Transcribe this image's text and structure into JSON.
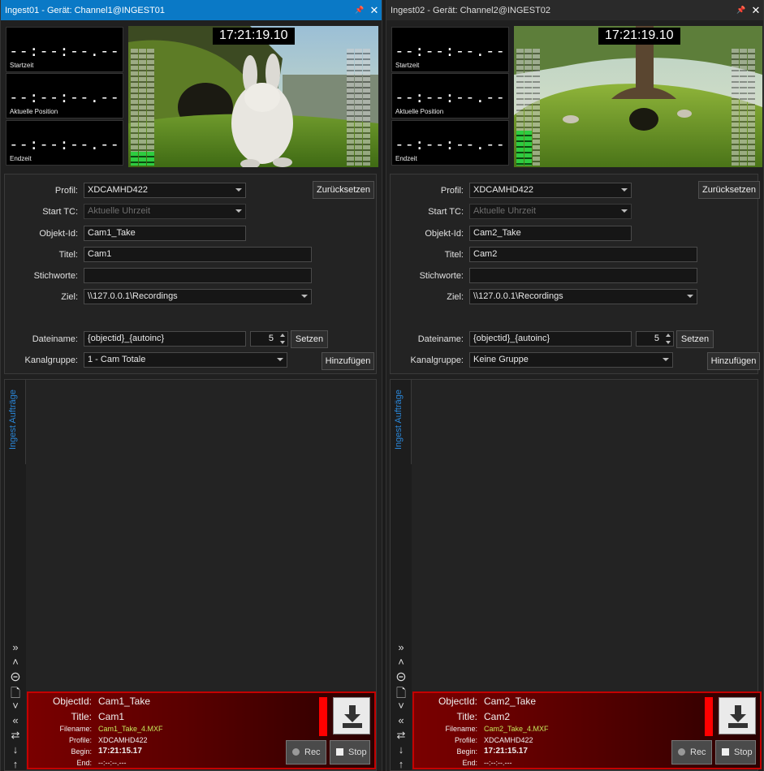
{
  "panels": [
    {
      "title": "Ingest01 - Gerät: Channel1@INGEST01",
      "timecodes": {
        "start": {
          "value": "--:--:--.--",
          "label": "Startzeit"
        },
        "current": {
          "value": "--:--:--.--",
          "label": "Aktuelle Position"
        },
        "end": {
          "value": "--:--:--.--",
          "label": "Endzeit"
        }
      },
      "video_timecode": "17:21:19.10",
      "meter_levels": [
        0.12,
        0.12,
        0.0,
        0.0
      ],
      "form": {
        "profil_label": "Profil:",
        "profil_value": "XDCAMHD422",
        "starttc_label": "Start TC:",
        "starttc_value": "Aktuelle Uhrzeit",
        "objektid_label": "Objekt-Id:",
        "objektid_value": "Cam1_Take",
        "titel_label": "Titel:",
        "titel_value": "Cam1",
        "stichworte_label": "Stichworte:",
        "stichworte_value": "",
        "ziel_label": "Ziel:",
        "ziel_value": "\\\\127.0.0.1\\Recordings",
        "dateiname_label": "Dateiname:",
        "dateiname_value": "{objectid}_{autoinc}",
        "counter_value": "5",
        "kanalgruppe_label": "Kanalgruppe:",
        "kanalgruppe_value": "1 - Cam Totale",
        "reset_label": "Zurücksetzen",
        "setzen_label": "Setzen",
        "add_label": "Hinzufügen"
      },
      "jobs_tab": "Ingest Aufträge",
      "record": {
        "objectid_label": "ObjectId:",
        "objectid": "Cam1_Take",
        "title_label": "Title:",
        "title": "Cam1",
        "filename_label": "Filename:",
        "filename": "Cam1_Take_4.MXF",
        "profile_label": "Profile:",
        "profile": "XDCAMHD422",
        "begin_label": "Begin:",
        "begin": "17:21:15.17",
        "end_label": "End:",
        "end": "--:--:--.---",
        "rec_label": "Rec",
        "stop_label": "Stop"
      }
    },
    {
      "title": "Ingest02 - Gerät: Channel2@INGEST02",
      "timecodes": {
        "start": {
          "value": "--:--:--.--",
          "label": "Startzeit"
        },
        "current": {
          "value": "--:--:--.--",
          "label": "Aktuelle Position"
        },
        "end": {
          "value": "--:--:--.--",
          "label": "Endzeit"
        }
      },
      "video_timecode": "17:21:19.10",
      "meter_levels": [
        0.3,
        0.3,
        0.0,
        0.0
      ],
      "form": {
        "profil_label": "Profil:",
        "profil_value": "XDCAMHD422",
        "starttc_label": "Start TC:",
        "starttc_value": "Aktuelle Uhrzeit",
        "objektid_label": "Objekt-Id:",
        "objektid_value": "Cam2_Take",
        "titel_label": "Titel:",
        "titel_value": "Cam2",
        "stichworte_label": "Stichworte:",
        "stichworte_value": "",
        "ziel_label": "Ziel:",
        "ziel_value": "\\\\127.0.0.1\\Recordings",
        "dateiname_label": "Dateiname:",
        "dateiname_value": "{objectid}_{autoinc}",
        "counter_value": "5",
        "kanalgruppe_label": "Kanalgruppe:",
        "kanalgruppe_value": "Keine Gruppe",
        "reset_label": "Zurücksetzen",
        "setzen_label": "Setzen",
        "add_label": "Hinzufügen"
      },
      "jobs_tab": "Ingest Aufträge",
      "record": {
        "objectid_label": "ObjectId:",
        "objectid": "Cam2_Take",
        "title_label": "Title:",
        "title": "Cam2",
        "filename_label": "Filename:",
        "filename": "Cam2_Take_4.MXF",
        "profile_label": "Profile:",
        "profile": "XDCAMHD422",
        "begin_label": "Begin:",
        "begin": "17:21:15.17",
        "end_label": "End:",
        "end": "--:--:--.---",
        "rec_label": "Rec",
        "stop_label": "Stop"
      }
    }
  ],
  "icons": {
    "pin": "pin-icon",
    "close": "close-icon",
    "sidebar": [
      "double-chevron-up-icon",
      "chevron-up-icon",
      "minus-circle-icon",
      "document-icon",
      "chevron-down-icon",
      "double-chevron-down-icon",
      "refresh-icon",
      "sort-down-clock-icon",
      "sort-up-clock-icon"
    ],
    "download": "download-icon"
  },
  "colors": {
    "active_title": "#0a79c6",
    "record_border": "#c40000",
    "record_indicator": "#ff0000",
    "filename": "#c6e85b",
    "jobs_tab_text": "#2a86d8"
  }
}
